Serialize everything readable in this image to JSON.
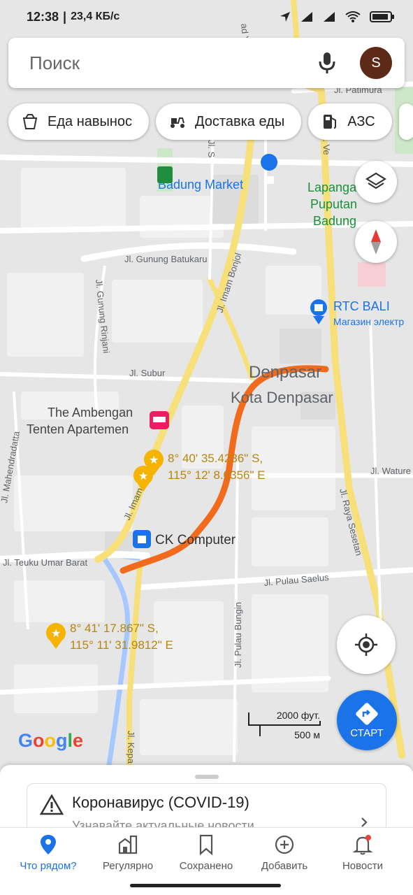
{
  "status_bar": {
    "time": "12:38",
    "speed": "23,4 КБ/с"
  },
  "search": {
    "placeholder": "Поиск",
    "avatar_letter": "S"
  },
  "chips": [
    {
      "label": "Еда навынос",
      "icon": "takeout-icon"
    },
    {
      "label": "Доставка еды",
      "icon": "delivery-scooter-icon"
    },
    {
      "label": "АЗС",
      "icon": "gas-station-icon"
    }
  ],
  "map": {
    "places": {
      "badung_market": "Badung Market",
      "lapangan_1": "Lapangan",
      "lapangan_2": "Puputan",
      "lapangan_3": "Badung",
      "rtc_bali": "RTC BALI",
      "rtc_sub": "Магазин электр",
      "denpasar_1": "Denpasar",
      "denpasar_2": "Kota Denpasar",
      "ambengan_1": "The Ambengan",
      "ambengan_2": "Tenten Apartemen",
      "ck_computer": "CK Computer",
      "pin1_line1": "8° 40' 35.4236\" S,",
      "pin1_line2": "115° 12' 8.0356\" E",
      "pin2_line1": "8° 41' 17.867\" S,",
      "pin2_line2": "115° 11' 31.9812\" E"
    },
    "streets": {
      "patimura": "Jl. Patimura",
      "gunung_batukaru": "Jl. Gunung Batukaru",
      "imam_bonjol": "Jl. Imam Bonjol",
      "imam_bonjol_2": "Jl. Imam Bonjol",
      "gunung_rinjani": "Jl. Gunung Rinjani",
      "subur": "Jl. Subur",
      "mahendradatta": "Jl. Mahendradatta",
      "teuku_umar_barat": "Jl. Teuku Umar Barat",
      "pulau_saelus": "Jl. Pulau Saelus",
      "pulau_bungin": "Jl. Pulau Bungin",
      "raya_sesetan": "Jl. Raya Sesetan",
      "waturenggong": "Jl. Wature",
      "kepaon": "Jl. Kepa",
      "ahmad_yani": "ad Yani",
      "veteran": "Jl. Ve",
      "s_st": "Jl. S"
    },
    "route_color": "#f26b1d",
    "scale_ft": "2000 фут.",
    "scale_m": "500 м",
    "google": "Google"
  },
  "start_button": "СТАРТ",
  "sheet": {
    "covid_title": "Коронавирус (COVID-19)",
    "covid_subtitle": "Узнавайте актуальные новости"
  },
  "nav": [
    {
      "label": "Что рядом?",
      "icon": "location-pin-icon",
      "active": true
    },
    {
      "label": "Регулярно",
      "icon": "commute-icon",
      "active": false
    },
    {
      "label": "Сохранено",
      "icon": "bookmark-icon",
      "active": false
    },
    {
      "label": "Добавить",
      "icon": "add-circle-icon",
      "active": false
    },
    {
      "label": "Новости",
      "icon": "bell-icon",
      "active": false
    }
  ],
  "colors": {
    "accent": "#1a73e8",
    "route": "#f26b1d",
    "poi_orange": "#c88a00",
    "poi_blue": "#1a73e8",
    "park_green": "#1e8e3e",
    "hotel_pink": "#e91e63"
  }
}
